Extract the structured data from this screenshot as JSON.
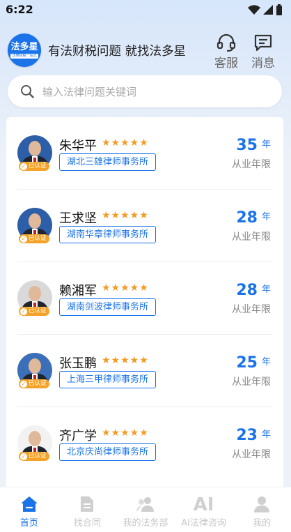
{
  "status": {
    "time": "6:22"
  },
  "header": {
    "logo_text": "法多星",
    "logo_sub": "法律财税一站式",
    "slogan": "有法财税问题  就找法多星",
    "service_label": "客服",
    "message_label": "消息"
  },
  "search": {
    "placeholder": "输入法律问题关键词"
  },
  "lawyers": [
    {
      "name": "朱华平",
      "firm": "湖北三雄律师事务所",
      "years": "35",
      "unit": "年",
      "years_label": "从业年限",
      "verified": "已认证",
      "rating": 5
    },
    {
      "name": "王求坚",
      "firm": "湖南华章律师事务所",
      "years": "28",
      "unit": "年",
      "years_label": "从业年限",
      "verified": "已认证",
      "rating": 5
    },
    {
      "name": "赖湘军",
      "firm": "湖南剑波律师事务所",
      "years": "28",
      "unit": "年",
      "years_label": "从业年限",
      "verified": "已认证",
      "rating": 5
    },
    {
      "name": "张玉鹏",
      "firm": "上海三甲律师事务所",
      "years": "25",
      "unit": "年",
      "years_label": "从业年限",
      "verified": "已认证",
      "rating": 5
    },
    {
      "name": "齐广学",
      "firm": "北京庆尚律师事务所",
      "years": "23",
      "unit": "年",
      "years_label": "从业年限",
      "verified": "已认证",
      "rating": 5
    }
  ],
  "tabs": [
    {
      "label": "首页",
      "icon": "home-icon",
      "active": true
    },
    {
      "label": "找合同",
      "icon": "document-icon"
    },
    {
      "label": "我的法务部",
      "icon": "team-icon"
    },
    {
      "label": "AI法律咨询",
      "icon": "ai-icon"
    },
    {
      "label": "我的",
      "icon": "user-icon"
    }
  ],
  "colors": {
    "accent": "#1a73e8",
    "star": "#f59a23",
    "badge": "#f4a32a"
  }
}
